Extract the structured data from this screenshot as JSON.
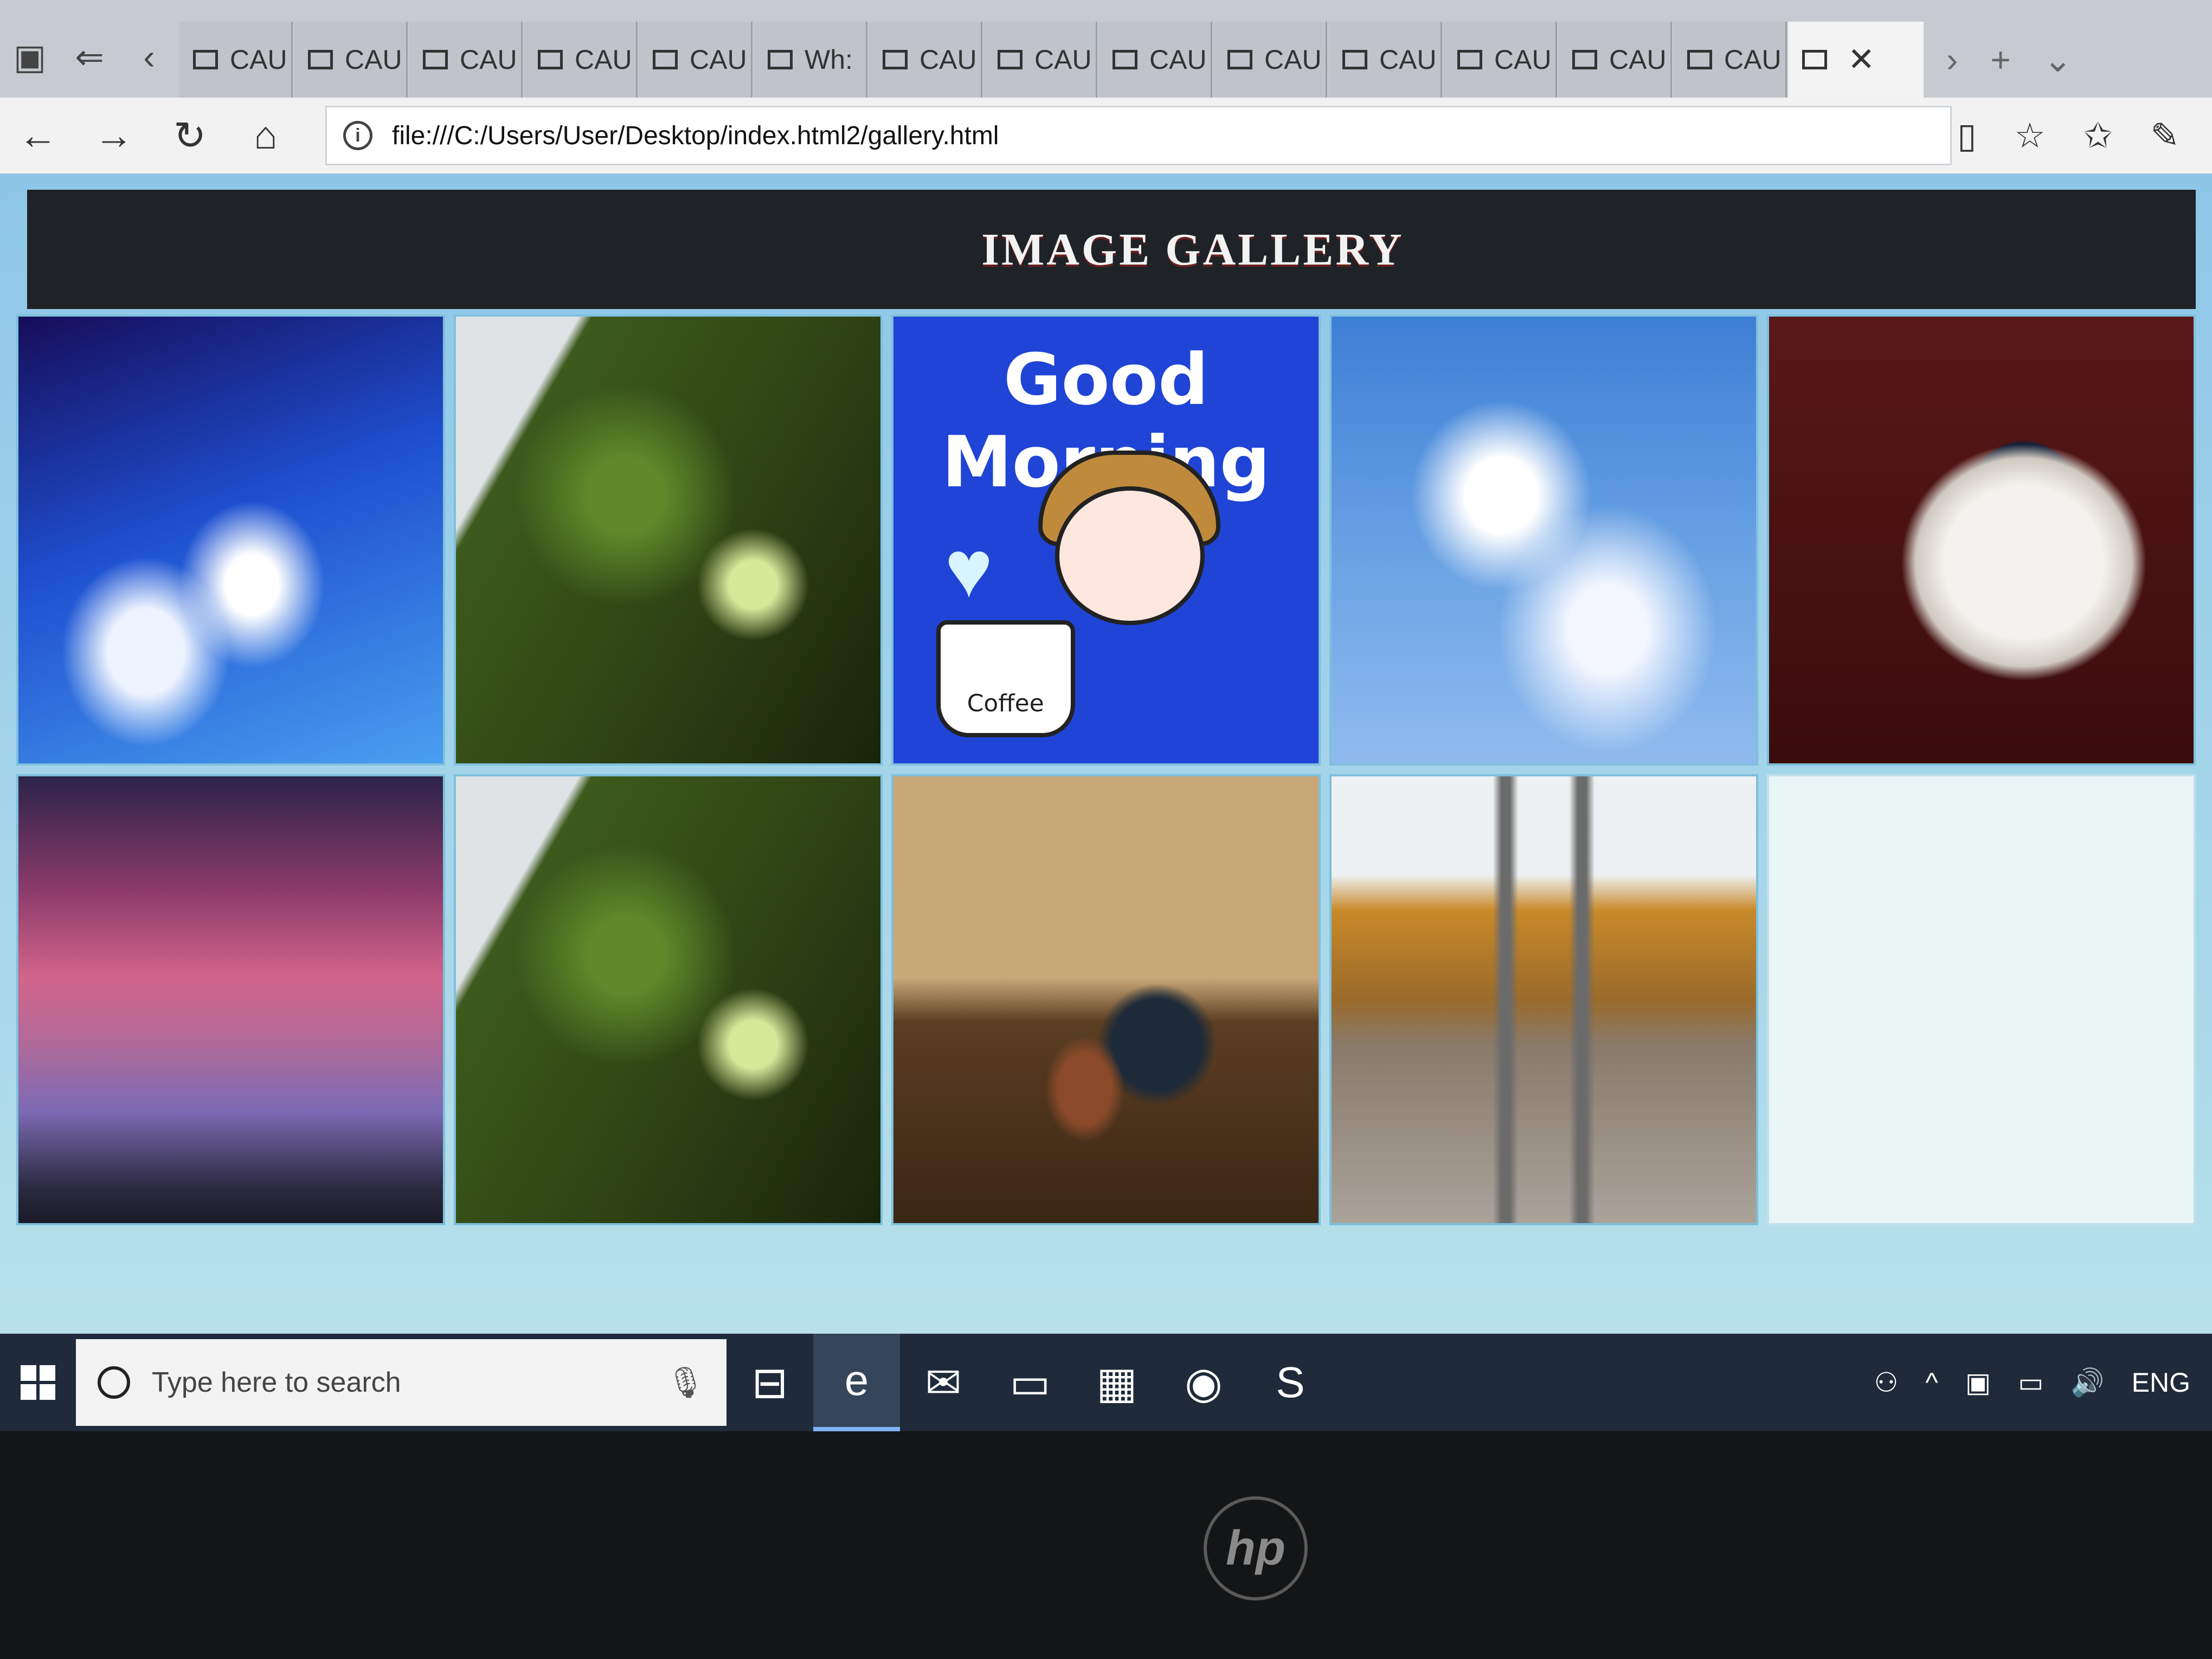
{
  "browser": {
    "tabs": [
      {
        "label": "CAU"
      },
      {
        "label": "CAU"
      },
      {
        "label": "CAU"
      },
      {
        "label": "CAU"
      },
      {
        "label": "CAU"
      },
      {
        "label": "Wh:"
      },
      {
        "label": "CAU"
      },
      {
        "label": "CAU"
      },
      {
        "label": "CAU"
      },
      {
        "label": "CAU"
      },
      {
        "label": "CAU"
      },
      {
        "label": "CAU"
      },
      {
        "label": "CAU"
      },
      {
        "label": "CAU"
      }
    ],
    "active_tab_close": "✕",
    "address": "file:///C:/Users/User/Desktop/index.html2/gallery.html"
  },
  "page": {
    "title": "IMAGE GALLERY",
    "good_morning": "Good Morning",
    "coffee_label": "Coffee",
    "photos": [
      {
        "name": "sky-photo"
      },
      {
        "name": "rain-umbrella-photo"
      },
      {
        "name": "good-morning-cartoon"
      },
      {
        "name": "clouds-photo"
      },
      {
        "name": "coffee-cup-photo"
      },
      {
        "name": "sunset-photo"
      },
      {
        "name": "rain-umbrella-photo-2"
      },
      {
        "name": "coffee-table-photo"
      },
      {
        "name": "railroad-autumn-photo"
      },
      {
        "name": "empty-slot"
      }
    ]
  },
  "taskbar": {
    "search_placeholder": "Type here to search",
    "language": "ENG"
  },
  "colors": {
    "page_background": "#a6d6ea",
    "title_bar": "#1f2327",
    "taskbar": "#1f2a3a"
  }
}
